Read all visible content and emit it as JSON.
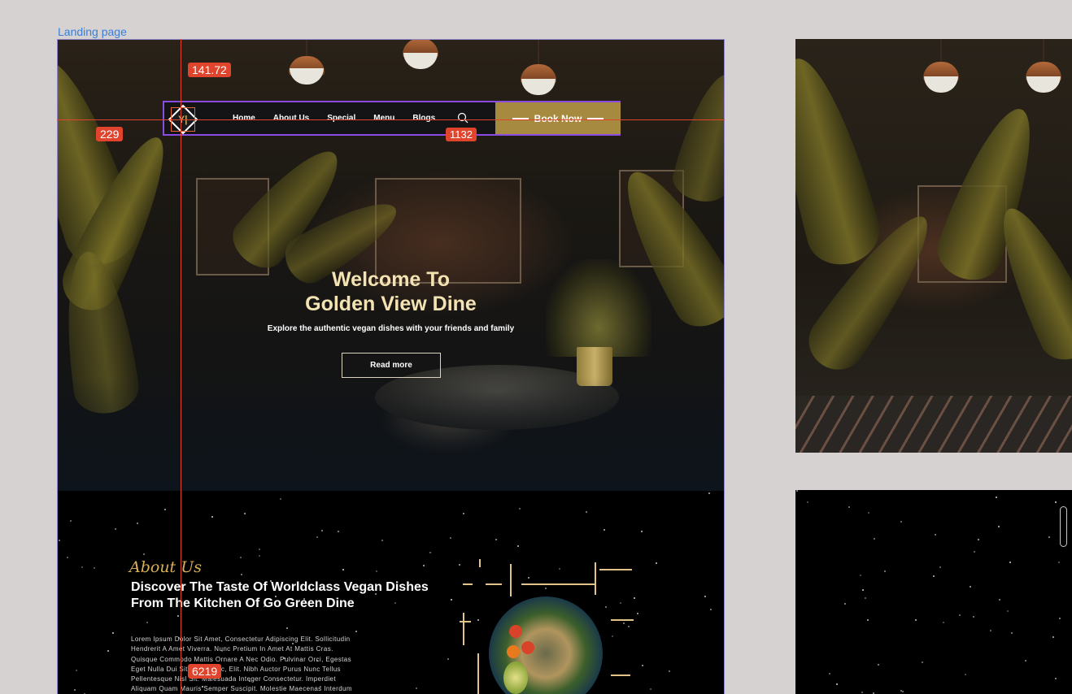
{
  "canvas": {
    "frame_label": "Landing page"
  },
  "nav": {
    "logo_icon": "fork-knife-diamond-logo",
    "links": [
      "Home",
      "About Us",
      "Special",
      "Menu",
      "Blogs"
    ],
    "search_icon": "search-icon",
    "book_label": "Book Now"
  },
  "hero": {
    "title_line1": "Welcome To",
    "title_line2": "Golden View Dine",
    "subtitle": "Explore the authentic vegan dishes with your friends and family",
    "cta_label": "Read more"
  },
  "about": {
    "script_label": "About Us",
    "title_line1": "Discover The Taste Of Worldclass Vegan Dishes",
    "title_line2": "From The Kitchen Of Go Green Dine",
    "body_lines": [
      "Lorem Ipsum Dolor Sit Amet, Consectetur Adipiscing Elit. Sollicitudin",
      "Hendrerit A Amet Viverra. Nunc Pretium In Amet At Mattis Cras.",
      "Quisque Commodo Mattis Ornare A Nec Odio. Pulvinar Orci, Egestas",
      "Eget Nulla Dui Sit Amet Nunc, Elit. Nibh Auctor Purus Nunc Tellus",
      "Pellentesque Nisl Sit. Malesuada Integer Consectetur. Imperdiet",
      "Aliquam Quam Mauris Semper Suscipit. Molestie Maecenas Interdum"
    ]
  },
  "measurements": {
    "top_spacing": "141.72",
    "left_spacing": "229",
    "width": "1132",
    "height": "6219"
  },
  "colors": {
    "accent_gold": "#a58a3f",
    "title_cream": "#f4e3b2",
    "guide_red": "#e0442d",
    "selection_purple": "#8a4be0"
  }
}
